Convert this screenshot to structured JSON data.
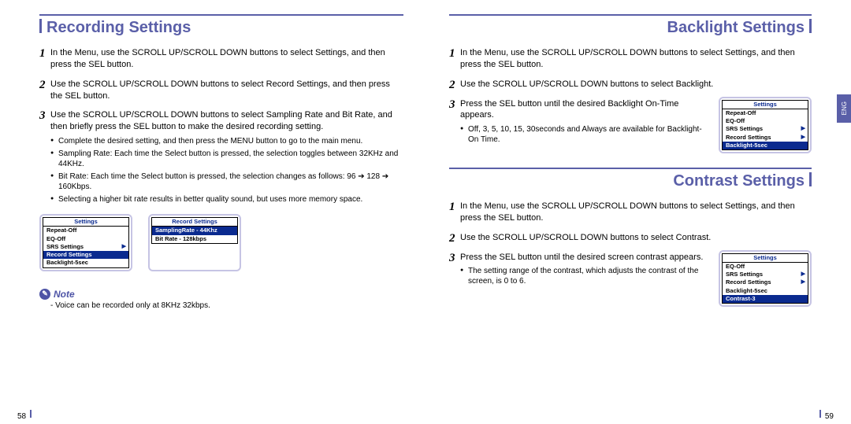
{
  "left": {
    "heading": "Recording Settings",
    "page_num": "58",
    "steps": [
      {
        "text": "In the Menu, use the SCROLL UP/SCROLL DOWN buttons to select Settings, and then press the SEL button.",
        "sub": []
      },
      {
        "text": "Use the SCROLL UP/SCROLL DOWN buttons to select Record Settings, and then press the SEL button.",
        "sub": []
      },
      {
        "text": "Use the SCROLL UP/SCROLL DOWN buttons to select Sampling Rate and Bit Rate, and then briefly press the SEL button to make the desired recording setting.",
        "sub": [
          "Complete the desired setting, and then press the MENU button to go to the main menu.",
          "Sampling Rate: Each time the Select button is pressed, the selection toggles between 32KHz and 44KHz.",
          "Bit Rate: Each time the Select button is pressed, the selection changes as follows: 96 ➔ 128 ➔ 160Kbps.",
          "Selecting a higher bit rate results in better quality sound, but uses more memory space."
        ]
      }
    ],
    "note_label": "Note",
    "note_text": "- Voice can be recorded only at 8KHz 32kbps.",
    "lcd_settings": {
      "title": "Settings",
      "lines": [
        {
          "t": "Repeat-Off",
          "sel": false,
          "arrow": false
        },
        {
          "t": "EQ-Off",
          "sel": false,
          "arrow": false
        },
        {
          "t": "SRS Settings",
          "sel": false,
          "arrow": true
        },
        {
          "t": "Record Settings",
          "sel": true,
          "arrow": true
        },
        {
          "t": "Backlight-5sec",
          "sel": false,
          "arrow": false
        }
      ]
    },
    "lcd_record": {
      "title": "Record Settings",
      "lines": [
        {
          "t": "SamplingRate - 44Khz",
          "sel": true,
          "arrow": false
        },
        {
          "t": "Bit Rate - 128kbps",
          "sel": false,
          "arrow": false
        }
      ]
    }
  },
  "right": {
    "headings": {
      "backlight": "Backlight Settings",
      "contrast": "Contrast Settings"
    },
    "lang": "ENG",
    "page_num": "59",
    "backlight_steps": [
      {
        "text": "In the Menu, use the SCROLL UP/SCROLL DOWN buttons to select Settings, and then press the SEL button.",
        "sub": []
      },
      {
        "text": "Use the SCROLL UP/SCROLL DOWN buttons to select Backlight.",
        "sub": []
      },
      {
        "text": "Press the SEL button until the desired Backlight On-Time appears.",
        "sub": [
          "Off, 3, 5, 10, 15, 30seconds and Always are available for Backlight-On Time."
        ]
      }
    ],
    "contrast_steps": [
      {
        "text": "In the Menu, use the SCROLL UP/SCROLL DOWN buttons to select Settings, and then press the SEL button.",
        "sub": []
      },
      {
        "text": "Use the SCROLL UP/SCROLL DOWN buttons to select Contrast.",
        "sub": []
      },
      {
        "text": "Press the SEL button until the desired screen contrast appears.",
        "sub": [
          "The setting range of the contrast, which adjusts the contrast of the screen, is 0 to 6."
        ]
      }
    ],
    "lcd_backlight": {
      "title": "Settings",
      "lines": [
        {
          "t": "Repeat-Off",
          "sel": false,
          "arrow": false
        },
        {
          "t": "EQ-Off",
          "sel": false,
          "arrow": false
        },
        {
          "t": "SRS Settings",
          "sel": false,
          "arrow": true
        },
        {
          "t": "Record Settings",
          "sel": false,
          "arrow": true
        },
        {
          "t": "Backlight-5sec",
          "sel": true,
          "arrow": false
        }
      ]
    },
    "lcd_contrast": {
      "title": "Settings",
      "lines": [
        {
          "t": "EQ-Off",
          "sel": false,
          "arrow": false
        },
        {
          "t": "SRS Settings",
          "sel": false,
          "arrow": true
        },
        {
          "t": "Record Settings",
          "sel": false,
          "arrow": true
        },
        {
          "t": "Backlight-5sec",
          "sel": false,
          "arrow": false
        },
        {
          "t": "Contrast-3",
          "sel": true,
          "arrow": false
        }
      ]
    }
  }
}
